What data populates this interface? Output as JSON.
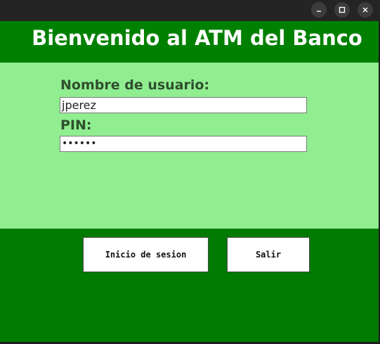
{
  "titlebar": {
    "controls": [
      {
        "name": "minimize",
        "icon": "minimize-icon"
      },
      {
        "name": "maximize",
        "icon": "maximize-icon"
      },
      {
        "name": "close",
        "icon": "close-icon"
      }
    ]
  },
  "header": {
    "title": "Bienvenido al ATM del Banco"
  },
  "form": {
    "username_label": "Nombre de usuario:",
    "username_value": "jperez",
    "pin_label": "PIN:",
    "pin_value": "••••••"
  },
  "actions": {
    "login_label": "Inicio de sesion",
    "exit_label": "Salir"
  },
  "colors": {
    "header_bg": "#008000",
    "form_bg": "#90ee90",
    "bottom_bg": "#007a00",
    "label_color": "#2f4f2f"
  }
}
